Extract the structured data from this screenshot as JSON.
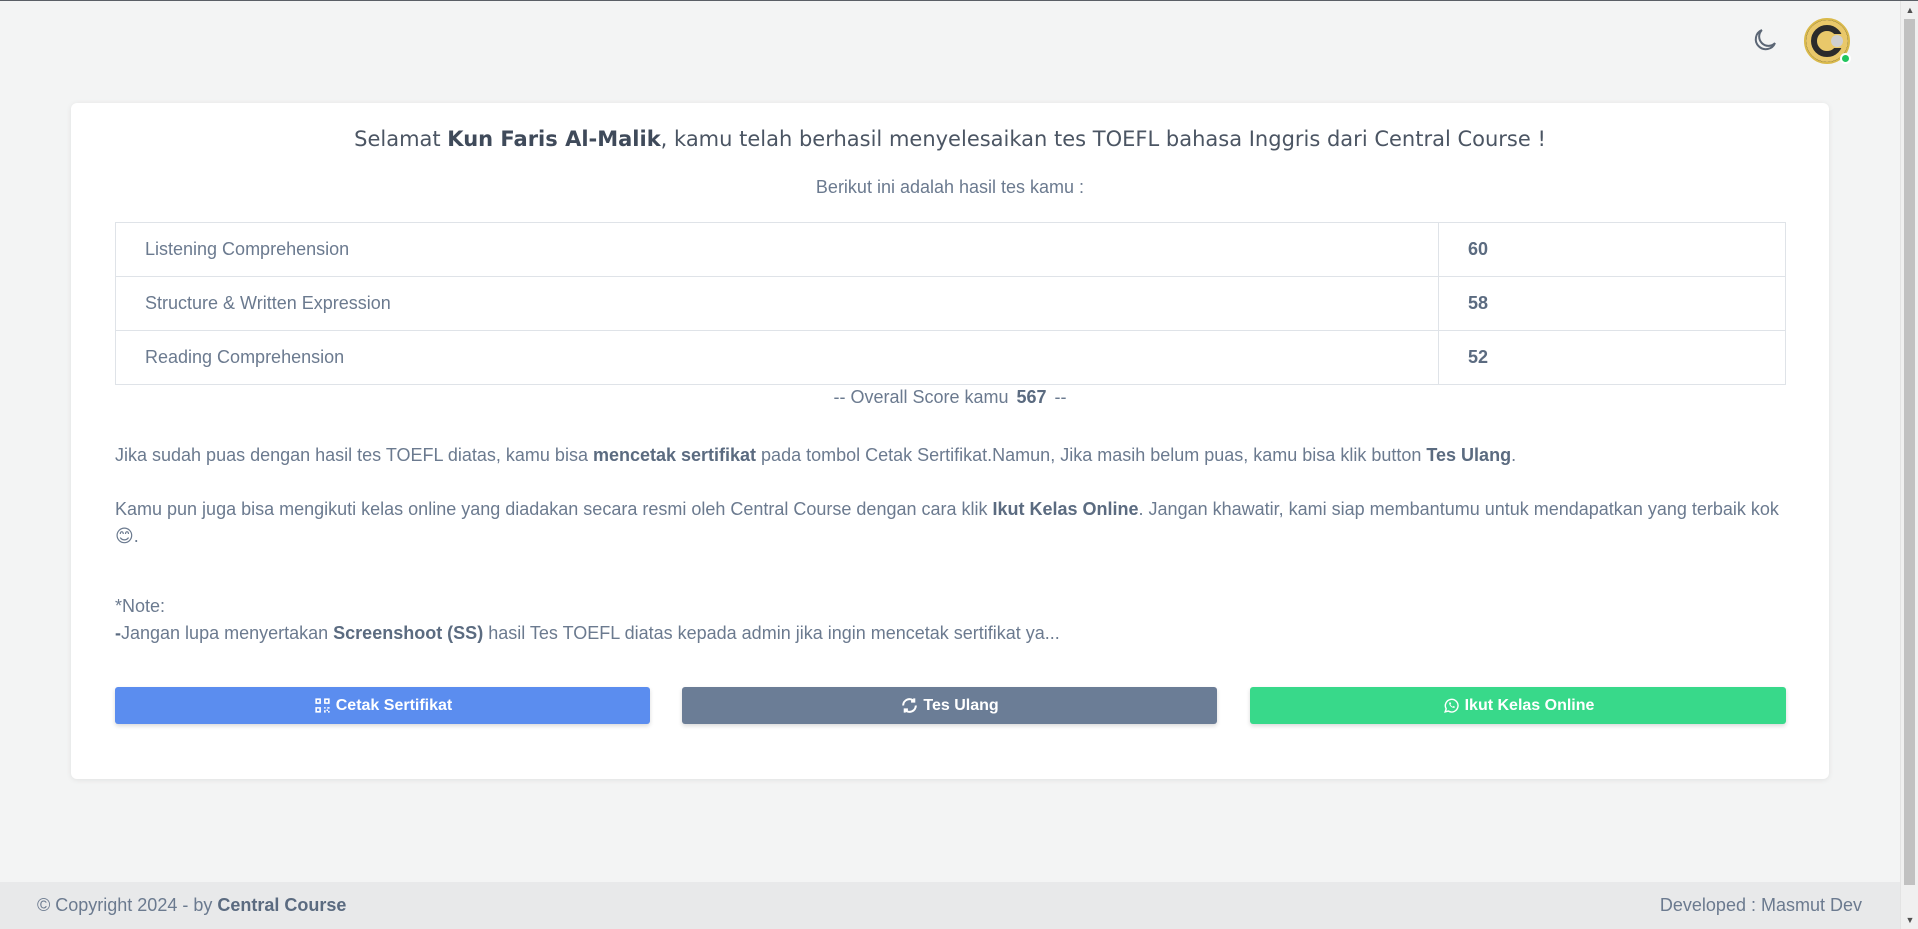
{
  "header": {
    "theme_toggle_icon": "moon-icon",
    "avatar_letter": "C"
  },
  "result": {
    "headline_prefix": "Selamat ",
    "user_name": "Kun Faris Al-Malik",
    "headline_suffix": ", kamu telah berhasil menyelesaikan tes TOEFL bahasa Inggris dari Central Course !",
    "subheading": "Berikut ini adalah hasil tes kamu :",
    "scores": [
      {
        "section": "Listening Comprehension",
        "score": "60"
      },
      {
        "section": "Structure & Written Expression",
        "score": "58"
      },
      {
        "section": "Reading Comprehension",
        "score": "52"
      }
    ],
    "overall_prefix": "-- Overall Score kamu",
    "overall_score": "567",
    "overall_suffix": "--"
  },
  "info": {
    "p1_a": "Jika sudah puas dengan hasil tes TOEFL diatas, kamu bisa ",
    "p1_b": "mencetak sertifikat",
    "p1_c": " pada tombol Cetak Sertifikat.Namun, Jika masih belum puas, kamu bisa klik button ",
    "p1_d": "Tes Ulang",
    "p1_e": ".",
    "p2_a": "Kamu pun juga bisa mengikuti kelas online yang diadakan secara resmi oleh Central Course dengan cara klik ",
    "p2_b": "Ikut Kelas Online",
    "p2_c": ". Jangan khawatir, kami siap membantumu untuk mendapatkan yang terbaik kok ",
    "p2_emoji": "😊",
    "p2_d": ".",
    "note_title": "*Note:",
    "note_a": "-",
    "note_b": "Jangan lupa menyertakan ",
    "note_c": "Screenshoot (SS)",
    "note_d": " hasil Tes TOEFL diatas kepada admin jika ingin mencetak sertifikat ya..."
  },
  "buttons": {
    "print_label": "Cetak Sertifikat",
    "retest_label": "Tes Ulang",
    "online_label": "Ikut Kelas Online"
  },
  "footer": {
    "copyright": "© Copyright 2024 - by ",
    "brand": "Central Course",
    "developer": "Developed : Masmut Dev"
  },
  "colors": {
    "print": "#5b8def",
    "retest": "#6b7d96",
    "online": "#38d98a"
  }
}
